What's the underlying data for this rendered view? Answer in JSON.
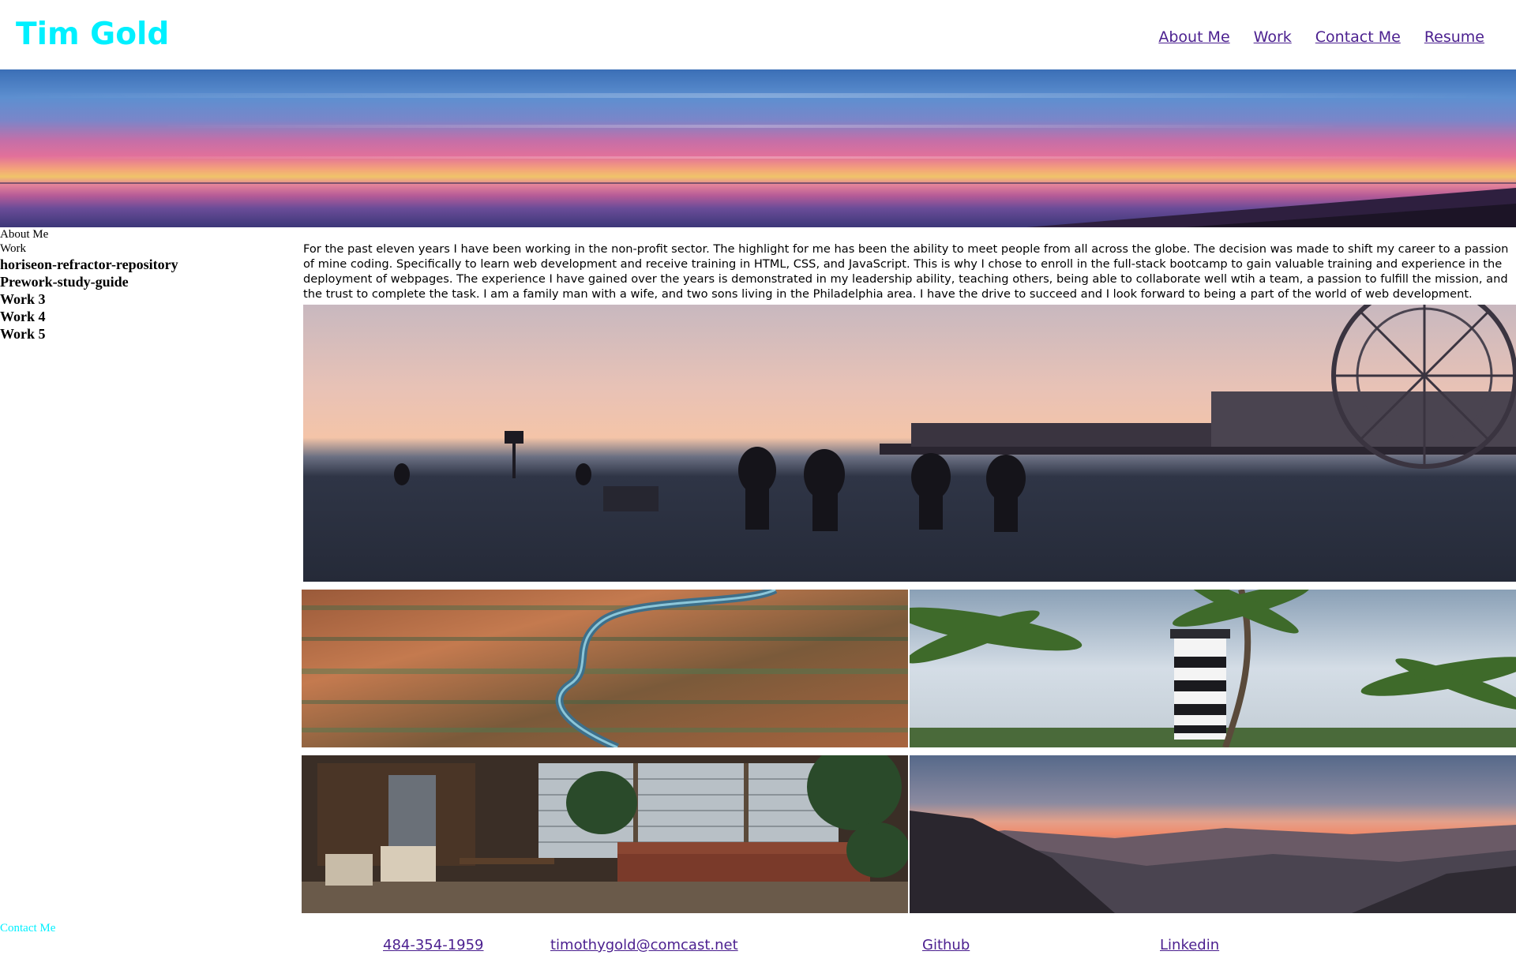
{
  "header": {
    "site_title": "Tim Gold",
    "title_color": "#00f0ff",
    "nav": [
      "About Me",
      "Work",
      "Contact Me",
      "Resume"
    ]
  },
  "sidebar": {
    "about_label": "About Me",
    "work_label": "Work",
    "projects": [
      "horiseon-refractor-repository",
      "Prework-study-guide",
      "Work 3",
      "Work 4",
      "Work 5"
    ],
    "contact_label": "Contact Me"
  },
  "about": {
    "text": "For the past eleven years I have been working in the non-profit sector. The highlight for me has been the ability to meet people from all across the globe. The decision was made to shift my career to a passion of mine coding. Specifically to learn web development and receive training in HTML, CSS, and JavaScript. This is why I chose to enroll in the full-stack bootcamp to gain valuable training and experience in the deployment of webpages. The experience I have gained over the years is demonstrated in my leadership ability, teaching others, being able to collaborate well wtih a team, a passion to fulfill the mission, and the trust to complete the task. I am a family man with a wife, and two sons living in the Philadelphia area. I have the drive to succeed and I look forward to being a part of the world of web development."
  },
  "footer": {
    "phone": "484-354-1959",
    "email": "timothygold@comcast.net",
    "github": "Github",
    "linkedin": "Linkedin"
  },
  "colors": {
    "link": "#4b1f8f",
    "accent": "#00f0ff"
  }
}
